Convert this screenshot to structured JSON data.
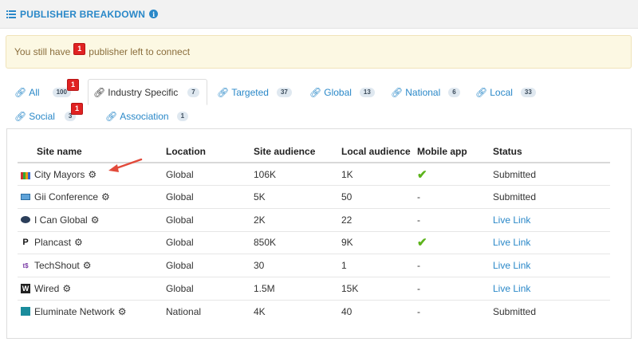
{
  "header": {
    "title": "PUBLISHER BREAKDOWN",
    "info_icon": "info-icon",
    "title_color": "#2a88c8"
  },
  "alert": {
    "text_before": "You still have",
    "count": "1",
    "text_after": "publisher left to connect"
  },
  "tabs": [
    {
      "label": "All",
      "count": "100",
      "alert_badge": "1",
      "active": false
    },
    {
      "label": "Industry Specific",
      "count": "7",
      "active": true
    },
    {
      "label": "Targeted",
      "count": "37",
      "active": false
    },
    {
      "label": "Global",
      "count": "13",
      "active": false
    },
    {
      "label": "National",
      "count": "6",
      "active": false
    },
    {
      "label": "Local",
      "count": "33",
      "active": false
    },
    {
      "label": "Social",
      "count": "3",
      "alert_badge": "1",
      "active": false
    },
    {
      "label": "Association",
      "count": "1",
      "active": false
    }
  ],
  "table": {
    "columns": [
      "Site name",
      "Location",
      "Site audience",
      "Local audience",
      "Mobile app",
      "Status"
    ],
    "rows": [
      {
        "site": "City Mayors",
        "location": "Global",
        "site_audience": "106K",
        "local_audience": "1K",
        "mobile": "✔",
        "status": "Submitted"
      },
      {
        "site": "Gii Conference",
        "location": "Global",
        "site_audience": "5K",
        "local_audience": "50",
        "mobile": "-",
        "status": "Submitted"
      },
      {
        "site": "I Can Global",
        "location": "Global",
        "site_audience": "2K",
        "local_audience": "22",
        "mobile": "-",
        "status": "Live Link"
      },
      {
        "site": "Plancast",
        "location": "Global",
        "site_audience": "850K",
        "local_audience": "9K",
        "mobile": "✔",
        "status": "Live Link"
      },
      {
        "site": "TechShout",
        "location": "Global",
        "site_audience": "30",
        "local_audience": "1",
        "mobile": "-",
        "status": "Live Link"
      },
      {
        "site": "Wired",
        "location": "Global",
        "site_audience": "1.5M",
        "local_audience": "15K",
        "mobile": "-",
        "status": "Live Link"
      },
      {
        "site": "Eluminate Network",
        "location": "National",
        "site_audience": "4K",
        "local_audience": "40",
        "mobile": "-",
        "status": "Submitted"
      }
    ]
  },
  "colors": {
    "accent": "#2a88c8",
    "alert_bg": "#fcf8e3",
    "badge_red": "#e02222",
    "check_green": "#5cb31b",
    "arrow_red": "#e24a3b"
  }
}
